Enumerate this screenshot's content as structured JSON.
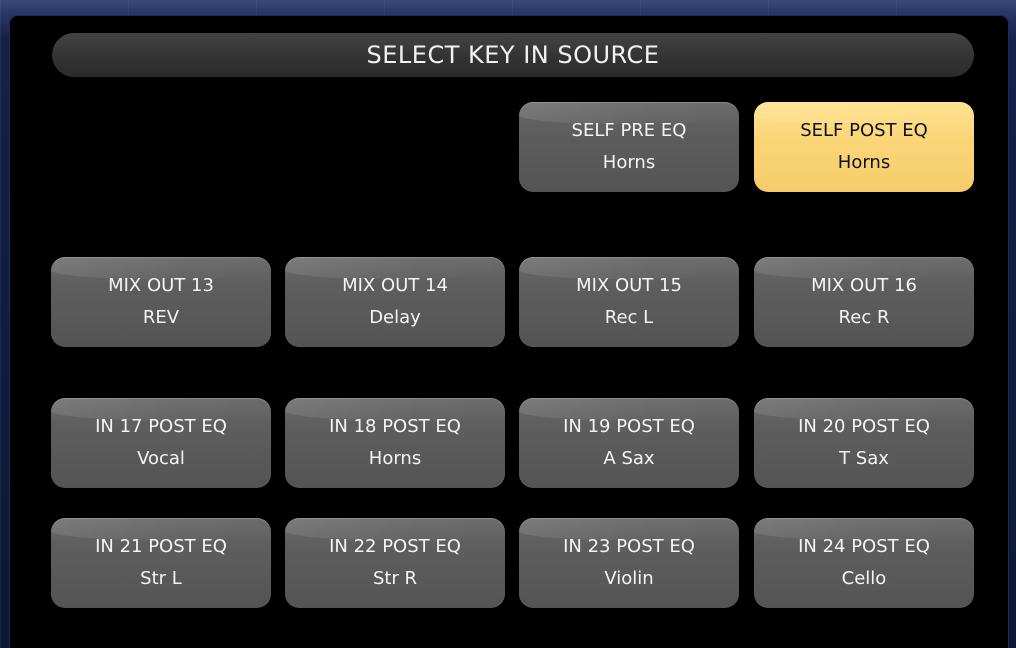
{
  "title": "SELECT KEY IN SOURCE",
  "colors": {
    "button_bg": "#5e5e5e",
    "selected_bg": "#fbd679",
    "panel_bg": "#000000"
  },
  "self_buttons": [
    {
      "line1": "SELF PRE EQ",
      "line2": "Horns",
      "selected": false
    },
    {
      "line1": "SELF POST EQ",
      "line2": "Horns",
      "selected": true
    }
  ],
  "mix_out_buttons": [
    {
      "line1": "MIX OUT 13",
      "line2": "REV"
    },
    {
      "line1": "MIX OUT 14",
      "line2": "Delay"
    },
    {
      "line1": "MIX OUT 15",
      "line2": "Rec L"
    },
    {
      "line1": "MIX OUT 16",
      "line2": "Rec R"
    }
  ],
  "input_buttons_row1": [
    {
      "line1": "IN 17 POST EQ",
      "line2": "Vocal"
    },
    {
      "line1": "IN 18 POST EQ",
      "line2": "Horns"
    },
    {
      "line1": "IN 19 POST EQ",
      "line2": "A Sax"
    },
    {
      "line1": "IN 20 POST EQ",
      "line2": "T Sax"
    }
  ],
  "input_buttons_row2": [
    {
      "line1": "IN 21 POST EQ",
      "line2": "Str L"
    },
    {
      "line1": "IN 22 POST EQ",
      "line2": "Str R"
    },
    {
      "line1": "IN 23 POST EQ",
      "line2": "Violin"
    },
    {
      "line1": "IN 24 POST EQ",
      "line2": "Cello"
    }
  ]
}
